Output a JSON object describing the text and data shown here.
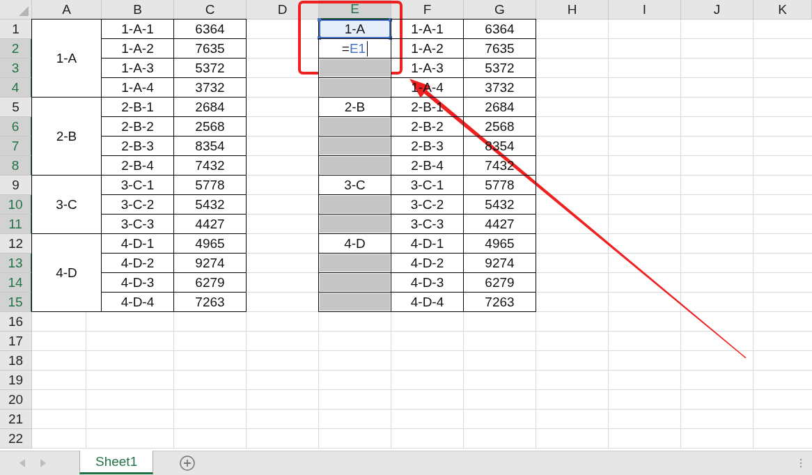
{
  "columns": [
    {
      "label": "A",
      "selected": false
    },
    {
      "label": "B",
      "selected": false
    },
    {
      "label": "C",
      "selected": false
    },
    {
      "label": "D",
      "selected": false
    },
    {
      "label": "E",
      "selected": true
    },
    {
      "label": "F",
      "selected": false
    },
    {
      "label": "G",
      "selected": false
    },
    {
      "label": "H",
      "selected": false
    },
    {
      "label": "I",
      "selected": false
    },
    {
      "label": "J",
      "selected": false
    },
    {
      "label": "K",
      "selected": false
    }
  ],
  "rows": [
    {
      "label": "1",
      "selected": false
    },
    {
      "label": "2",
      "selected": true
    },
    {
      "label": "3",
      "selected": true
    },
    {
      "label": "4",
      "selected": true
    },
    {
      "label": "5",
      "selected": false
    },
    {
      "label": "6",
      "selected": true
    },
    {
      "label": "7",
      "selected": true
    },
    {
      "label": "8",
      "selected": true
    },
    {
      "label": "9",
      "selected": false
    },
    {
      "label": "10",
      "selected": true
    },
    {
      "label": "11",
      "selected": true
    },
    {
      "label": "12",
      "selected": false
    },
    {
      "label": "13",
      "selected": true
    },
    {
      "label": "14",
      "selected": true
    },
    {
      "label": "15",
      "selected": true
    },
    {
      "label": "16",
      "selected": false
    },
    {
      "label": "17",
      "selected": false
    },
    {
      "label": "18",
      "selected": false
    },
    {
      "label": "19",
      "selected": false
    },
    {
      "label": "20",
      "selected": false
    },
    {
      "label": "21",
      "selected": false
    },
    {
      "label": "22",
      "selected": false
    }
  ],
  "left_table": {
    "groups": [
      {
        "label": "1-A",
        "items": [
          {
            "code": "1-A-1",
            "value": "6364"
          },
          {
            "code": "1-A-2",
            "value": "7635"
          },
          {
            "code": "1-A-3",
            "value": "5372"
          },
          {
            "code": "1-A-4",
            "value": "3732"
          }
        ]
      },
      {
        "label": "2-B",
        "items": [
          {
            "code": "2-B-1",
            "value": "2684"
          },
          {
            "code": "2-B-2",
            "value": "2568"
          },
          {
            "code": "2-B-3",
            "value": "8354"
          },
          {
            "code": "2-B-4",
            "value": "7432"
          }
        ]
      },
      {
        "label": "3-C",
        "items": [
          {
            "code": "3-C-1",
            "value": "5778"
          },
          {
            "code": "3-C-2",
            "value": "5432"
          },
          {
            "code": "3-C-3",
            "value": "4427"
          }
        ]
      },
      {
        "label": "4-D",
        "items": [
          {
            "code": "4-D-1",
            "value": "4965"
          },
          {
            "code": "4-D-2",
            "value": "9274"
          },
          {
            "code": "4-D-3",
            "value": "6279"
          },
          {
            "code": "4-D-4",
            "value": "7263"
          }
        ]
      }
    ]
  },
  "right_table": {
    "rows": [
      {
        "e": {
          "kind": "reference",
          "text": "1-A"
        },
        "code": "1-A-1",
        "value": "6364"
      },
      {
        "e": {
          "kind": "formula",
          "operator": "=",
          "reference": "E1"
        },
        "code": "1-A-2",
        "value": "7635"
      },
      {
        "e": {
          "kind": "blank",
          "selected": true
        },
        "code": "1-A-3",
        "value": "5372"
      },
      {
        "e": {
          "kind": "blank",
          "selected": true
        },
        "code": "1-A-4",
        "value": "3732"
      },
      {
        "e": {
          "kind": "text",
          "text": "2-B"
        },
        "code": "2-B-1",
        "value": "2684"
      },
      {
        "e": {
          "kind": "blank",
          "selected": true
        },
        "code": "2-B-2",
        "value": "2568"
      },
      {
        "e": {
          "kind": "blank",
          "selected": true
        },
        "code": "2-B-3",
        "value": "8354"
      },
      {
        "e": {
          "kind": "blank",
          "selected": true
        },
        "code": "2-B-4",
        "value": "7432"
      },
      {
        "e": {
          "kind": "text",
          "text": "3-C"
        },
        "code": "3-C-1",
        "value": "5778"
      },
      {
        "e": {
          "kind": "blank",
          "selected": true
        },
        "code": "3-C-2",
        "value": "5432"
      },
      {
        "e": {
          "kind": "blank",
          "selected": true
        },
        "code": "3-C-3",
        "value": "4427"
      },
      {
        "e": {
          "kind": "text",
          "text": "4-D"
        },
        "code": "4-D-1",
        "value": "4965"
      },
      {
        "e": {
          "kind": "blank",
          "selected": true
        },
        "code": "4-D-2",
        "value": "9274"
      },
      {
        "e": {
          "kind": "blank",
          "selected": true
        },
        "code": "4-D-3",
        "value": "6279"
      },
      {
        "e": {
          "kind": "blank",
          "selected": true
        },
        "code": "4-D-4",
        "value": "7263"
      }
    ]
  },
  "sheet_tabs": [
    {
      "label": "Sheet1",
      "selected": true
    }
  ]
}
